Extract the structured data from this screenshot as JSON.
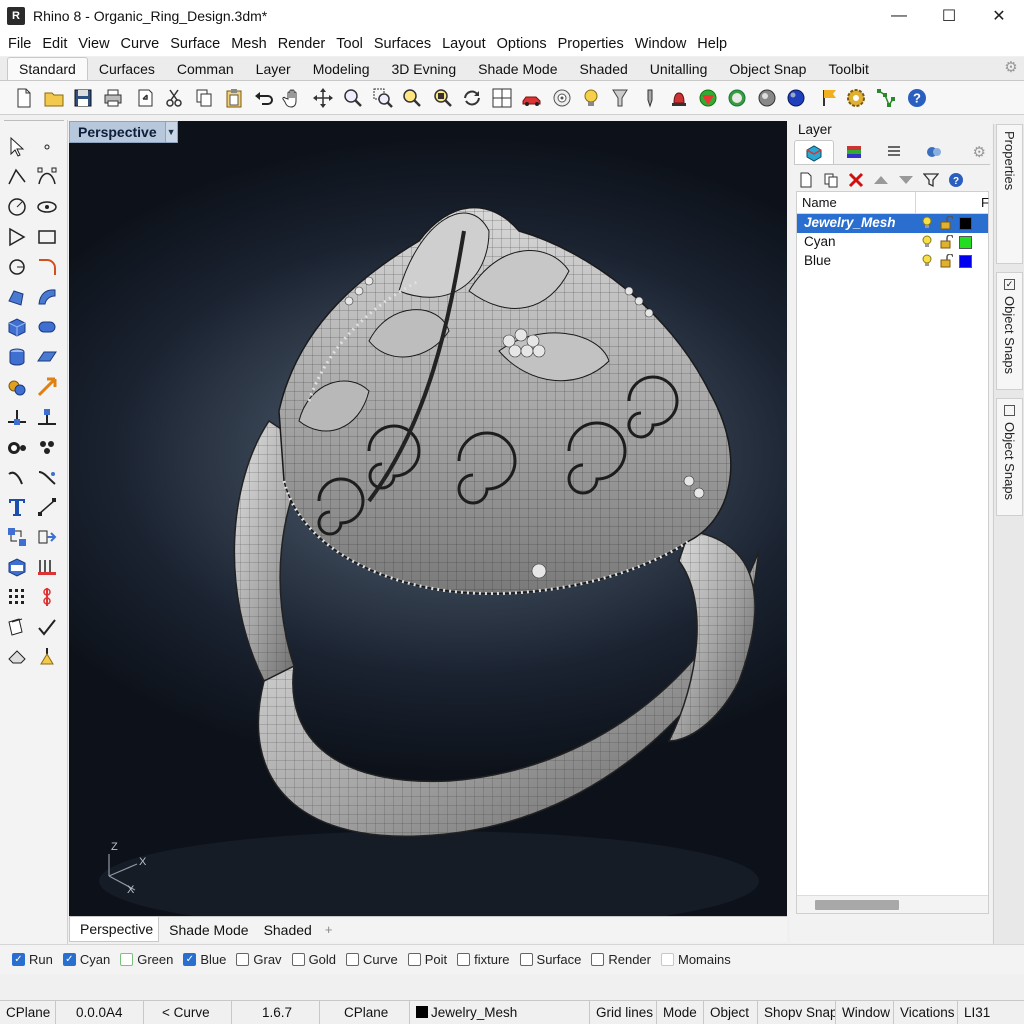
{
  "window": {
    "title": "Rhino 8 - Organic_Ring_Design.3dm*",
    "minimize": "—",
    "maximize": "☐",
    "close": "✕"
  },
  "menu": [
    "File",
    "Edit",
    "View",
    "Curve",
    "Surface",
    "Mesh",
    "Render",
    "Tool",
    "Surfaces",
    "Layout",
    "Options",
    "Properties",
    "Window",
    "Help"
  ],
  "toolbar_tabs": [
    "Standard",
    "Curfaces",
    "Comman",
    "Layer",
    "Modeling",
    "3D Evning",
    "Shade Mode",
    "Shaded",
    "Unitalling",
    "Object Snap",
    "Toolbit"
  ],
  "active_toolbar_tab": "Standard",
  "toolbar_icons": [
    "new-file",
    "open-folder",
    "save",
    "print",
    "import",
    "cut",
    "copy",
    "paste",
    "undo",
    "pan",
    "move",
    "zoom",
    "zoom-window",
    "zoom-extents",
    "zoom-selected",
    "rotate-view",
    "four-views",
    "car-render",
    "target",
    "light",
    "spotlight",
    "pen",
    "bell",
    "render-flower",
    "render-sphere-green",
    "render-sphere-grey",
    "render-sphere-blue",
    "flag",
    "gear-gold",
    "points",
    "help"
  ],
  "viewport": {
    "name": "Perspective",
    "axis_z": "Z",
    "axis_x": "X",
    "axis_x2": "X"
  },
  "viewport_tabs": [
    "Perspective",
    "Shade Mode",
    "Shaded"
  ],
  "viewport_tab_add": "+",
  "layer_panel": {
    "title": "Layer",
    "columns": {
      "name": "Name",
      "f": "F"
    },
    "layers": [
      {
        "name": "Jewelry_Mesh",
        "color": "#000000",
        "selected": true
      },
      {
        "name": "Cyan",
        "color": "#22dd22",
        "selected": false
      },
      {
        "name": "Blue",
        "color": "#0000ee",
        "selected": false
      }
    ]
  },
  "side_tabs": [
    "Properties",
    "Object Snaps",
    "Object Snaps"
  ],
  "osnaps": [
    {
      "label": "Run",
      "state": "on"
    },
    {
      "label": "Cyan",
      "state": "on"
    },
    {
      "label": "Green",
      "state": "green"
    },
    {
      "label": "Blue",
      "state": "on"
    },
    {
      "label": "Grav",
      "state": "off"
    },
    {
      "label": "Gold",
      "state": "off"
    },
    {
      "label": "Curve",
      "state": "off"
    },
    {
      "label": "Poit",
      "state": "off"
    },
    {
      "label": "fixture",
      "state": "off"
    },
    {
      "label": "Surface",
      "state": "off"
    },
    {
      "label": "Render",
      "state": "off"
    },
    {
      "label": "Momains",
      "state": "faded"
    }
  ],
  "status": {
    "cplane": "CPlane",
    "coords": "0.0.0A4",
    "curve": "< Curve",
    "value": "1.6.7",
    "cplane2": "CPlane",
    "layer": "Jewelry_Mesh",
    "grid": "Grid lines",
    "mode": "Mode",
    "object": "Object",
    "snap": "Shopv Snap",
    "window": "Window",
    "vications": "Vications",
    "li": "LI31"
  }
}
